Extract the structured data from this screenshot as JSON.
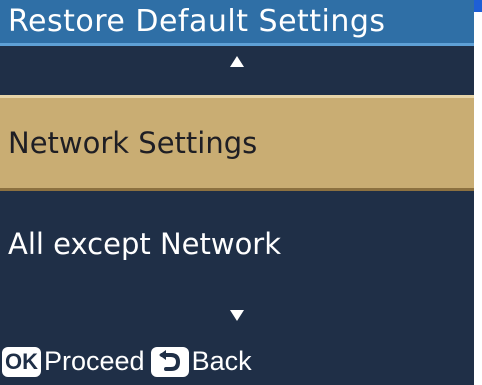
{
  "screen": {
    "title": "Restore Default Settings"
  },
  "menu": {
    "items": [
      {
        "label": "Network Settings",
        "selected": true
      },
      {
        "label": "All except Network",
        "selected": false
      }
    ]
  },
  "footer": {
    "ok_key": "OK",
    "proceed_label": "Proceed",
    "back_label": "Back"
  },
  "icons": {
    "scroll_up": "triangle-up-icon",
    "scroll_down": "triangle-down-icon",
    "back": "return-arrow-icon"
  },
  "colors": {
    "background": "#1f2f47",
    "title_bar": "#2f6fa6",
    "selection": "#c9ad73",
    "text": "#ffffff"
  }
}
